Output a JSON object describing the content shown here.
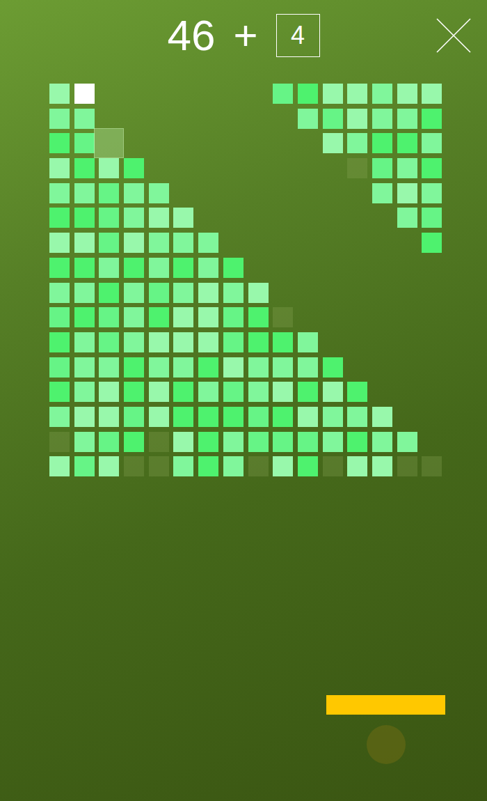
{
  "score": {
    "value": "46",
    "plus": "+",
    "bonus": "4"
  },
  "bricks": {
    "rows": [
      [
        {
          "kind": "brick",
          "color": "#98f8ab"
        },
        {
          "kind": "ball"
        },
        {
          "kind": "empty"
        },
        {
          "kind": "empty"
        },
        {
          "kind": "empty"
        },
        {
          "kind": "empty"
        },
        {
          "kind": "empty"
        },
        {
          "kind": "empty"
        },
        {
          "kind": "empty"
        },
        {
          "kind": "brick",
          "color": "#66f486"
        },
        {
          "kind": "brick",
          "color": "#4ef26e"
        },
        {
          "kind": "brick",
          "color": "#98f8ab"
        },
        {
          "kind": "brick",
          "color": "#98f8ab"
        },
        {
          "kind": "brick",
          "color": "#80f69b"
        },
        {
          "kind": "brick",
          "color": "#98f8ab"
        },
        {
          "kind": "brick",
          "color": "#98f8ab"
        }
      ],
      [
        {
          "kind": "brick",
          "color": "#80f69b"
        },
        {
          "kind": "brick",
          "color": "#80f69b"
        },
        {
          "kind": "empty"
        },
        {
          "kind": "empty"
        },
        {
          "kind": "empty"
        },
        {
          "kind": "empty"
        },
        {
          "kind": "empty"
        },
        {
          "kind": "empty"
        },
        {
          "kind": "empty"
        },
        {
          "kind": "empty"
        },
        {
          "kind": "brick",
          "color": "#80f69b"
        },
        {
          "kind": "brick",
          "color": "#66f486"
        },
        {
          "kind": "brick",
          "color": "#98f8ab"
        },
        {
          "kind": "brick",
          "color": "#80f69b"
        },
        {
          "kind": "brick",
          "color": "#80f69b"
        },
        {
          "kind": "brick",
          "color": "#4ef26e"
        }
      ],
      [
        {
          "kind": "brick",
          "color": "#4ef26e"
        },
        {
          "kind": "brick",
          "color": "#66f486"
        },
        {
          "kind": "fading"
        },
        {
          "kind": "empty"
        },
        {
          "kind": "empty"
        },
        {
          "kind": "empty"
        },
        {
          "kind": "empty"
        },
        {
          "kind": "empty"
        },
        {
          "kind": "empty"
        },
        {
          "kind": "empty"
        },
        {
          "kind": "empty"
        },
        {
          "kind": "brick",
          "color": "#98f8ab"
        },
        {
          "kind": "brick",
          "color": "#80f69b"
        },
        {
          "kind": "brick",
          "color": "#4ef26e"
        },
        {
          "kind": "brick",
          "color": "#4ef26e"
        },
        {
          "kind": "brick",
          "color": "#80f69b"
        }
      ],
      [
        {
          "kind": "brick",
          "color": "#98f8ab"
        },
        {
          "kind": "brick",
          "color": "#4ef26e"
        },
        {
          "kind": "brick",
          "color": "#98f8ab"
        },
        {
          "kind": "brick",
          "color": "#4ef26e"
        },
        {
          "kind": "empty"
        },
        {
          "kind": "empty"
        },
        {
          "kind": "empty"
        },
        {
          "kind": "empty"
        },
        {
          "kind": "empty"
        },
        {
          "kind": "empty"
        },
        {
          "kind": "empty"
        },
        {
          "kind": "empty"
        },
        {
          "kind": "hit"
        },
        {
          "kind": "brick",
          "color": "#66f486"
        },
        {
          "kind": "brick",
          "color": "#80f69b"
        },
        {
          "kind": "brick",
          "color": "#4ef26e"
        }
      ],
      [
        {
          "kind": "brick",
          "color": "#80f69b"
        },
        {
          "kind": "brick",
          "color": "#80f69b"
        },
        {
          "kind": "brick",
          "color": "#66f486"
        },
        {
          "kind": "brick",
          "color": "#80f69b"
        },
        {
          "kind": "brick",
          "color": "#80f69b"
        },
        {
          "kind": "empty"
        },
        {
          "kind": "empty"
        },
        {
          "kind": "empty"
        },
        {
          "kind": "empty"
        },
        {
          "kind": "empty"
        },
        {
          "kind": "empty"
        },
        {
          "kind": "empty"
        },
        {
          "kind": "empty"
        },
        {
          "kind": "brick",
          "color": "#80f69b"
        },
        {
          "kind": "brick",
          "color": "#98f8ab"
        },
        {
          "kind": "brick",
          "color": "#80f69b"
        }
      ],
      [
        {
          "kind": "brick",
          "color": "#4ef26e"
        },
        {
          "kind": "brick",
          "color": "#4ef26e"
        },
        {
          "kind": "brick",
          "color": "#66f486"
        },
        {
          "kind": "brick",
          "color": "#80f69b"
        },
        {
          "kind": "brick",
          "color": "#98f8ab"
        },
        {
          "kind": "brick",
          "color": "#98f8ab"
        },
        {
          "kind": "empty"
        },
        {
          "kind": "empty"
        },
        {
          "kind": "empty"
        },
        {
          "kind": "empty"
        },
        {
          "kind": "empty"
        },
        {
          "kind": "empty"
        },
        {
          "kind": "empty"
        },
        {
          "kind": "empty"
        },
        {
          "kind": "brick",
          "color": "#80f69b"
        },
        {
          "kind": "brick",
          "color": "#66f486"
        }
      ],
      [
        {
          "kind": "brick",
          "color": "#98f8ab"
        },
        {
          "kind": "brick",
          "color": "#98f8ab"
        },
        {
          "kind": "brick",
          "color": "#66f486"
        },
        {
          "kind": "brick",
          "color": "#98f8ab"
        },
        {
          "kind": "brick",
          "color": "#80f69b"
        },
        {
          "kind": "brick",
          "color": "#80f69b"
        },
        {
          "kind": "brick",
          "color": "#80f69b"
        },
        {
          "kind": "empty"
        },
        {
          "kind": "empty"
        },
        {
          "kind": "empty"
        },
        {
          "kind": "empty"
        },
        {
          "kind": "empty"
        },
        {
          "kind": "empty"
        },
        {
          "kind": "empty"
        },
        {
          "kind": "empty"
        },
        {
          "kind": "brick",
          "color": "#4ef26e"
        }
      ],
      [
        {
          "kind": "brick",
          "color": "#4ef26e"
        },
        {
          "kind": "brick",
          "color": "#4ef26e"
        },
        {
          "kind": "brick",
          "color": "#80f69b"
        },
        {
          "kind": "brick",
          "color": "#4ef26e"
        },
        {
          "kind": "brick",
          "color": "#80f69b"
        },
        {
          "kind": "brick",
          "color": "#4ef26e"
        },
        {
          "kind": "brick",
          "color": "#80f69b"
        },
        {
          "kind": "brick",
          "color": "#4ef26e"
        },
        {
          "kind": "empty"
        },
        {
          "kind": "empty"
        },
        {
          "kind": "empty"
        },
        {
          "kind": "empty"
        },
        {
          "kind": "empty"
        },
        {
          "kind": "empty"
        },
        {
          "kind": "empty"
        },
        {
          "kind": "empty"
        }
      ],
      [
        {
          "kind": "brick",
          "color": "#80f69b"
        },
        {
          "kind": "brick",
          "color": "#80f69b"
        },
        {
          "kind": "brick",
          "color": "#4ef26e"
        },
        {
          "kind": "brick",
          "color": "#80f69b"
        },
        {
          "kind": "brick",
          "color": "#66f486"
        },
        {
          "kind": "brick",
          "color": "#80f69b"
        },
        {
          "kind": "brick",
          "color": "#98f8ab"
        },
        {
          "kind": "brick",
          "color": "#80f69b"
        },
        {
          "kind": "brick",
          "color": "#98f8ab"
        },
        {
          "kind": "empty"
        },
        {
          "kind": "empty"
        },
        {
          "kind": "empty"
        },
        {
          "kind": "empty"
        },
        {
          "kind": "empty"
        },
        {
          "kind": "empty"
        },
        {
          "kind": "empty"
        }
      ],
      [
        {
          "kind": "brick",
          "color": "#66f486"
        },
        {
          "kind": "brick",
          "color": "#4ef26e"
        },
        {
          "kind": "brick",
          "color": "#66f486"
        },
        {
          "kind": "brick",
          "color": "#80f69b"
        },
        {
          "kind": "brick",
          "color": "#4ef26e"
        },
        {
          "kind": "brick",
          "color": "#98f8ab"
        },
        {
          "kind": "brick",
          "color": "#98f8ab"
        },
        {
          "kind": "brick",
          "color": "#66f486"
        },
        {
          "kind": "brick",
          "color": "#4ef26e"
        },
        {
          "kind": "hit"
        },
        {
          "kind": "empty"
        },
        {
          "kind": "empty"
        },
        {
          "kind": "empty"
        },
        {
          "kind": "empty"
        },
        {
          "kind": "empty"
        },
        {
          "kind": "empty"
        }
      ],
      [
        {
          "kind": "brick",
          "color": "#4ef26e"
        },
        {
          "kind": "brick",
          "color": "#80f69b"
        },
        {
          "kind": "brick",
          "color": "#66f486"
        },
        {
          "kind": "brick",
          "color": "#80f69b"
        },
        {
          "kind": "brick",
          "color": "#98f8ab"
        },
        {
          "kind": "brick",
          "color": "#98f8ab"
        },
        {
          "kind": "brick",
          "color": "#98f8ab"
        },
        {
          "kind": "brick",
          "color": "#66f486"
        },
        {
          "kind": "brick",
          "color": "#4ef26e"
        },
        {
          "kind": "brick",
          "color": "#4ef26e"
        },
        {
          "kind": "brick",
          "color": "#80f69b"
        },
        {
          "kind": "empty"
        },
        {
          "kind": "empty"
        },
        {
          "kind": "empty"
        },
        {
          "kind": "empty"
        },
        {
          "kind": "empty"
        }
      ],
      [
        {
          "kind": "brick",
          "color": "#66f486"
        },
        {
          "kind": "brick",
          "color": "#80f69b"
        },
        {
          "kind": "brick",
          "color": "#80f69b"
        },
        {
          "kind": "brick",
          "color": "#4ef26e"
        },
        {
          "kind": "brick",
          "color": "#80f69b"
        },
        {
          "kind": "brick",
          "color": "#80f69b"
        },
        {
          "kind": "brick",
          "color": "#4ef26e"
        },
        {
          "kind": "brick",
          "color": "#98f8ab"
        },
        {
          "kind": "brick",
          "color": "#80f69b"
        },
        {
          "kind": "brick",
          "color": "#80f69b"
        },
        {
          "kind": "brick",
          "color": "#80f69b"
        },
        {
          "kind": "brick",
          "color": "#4ef26e"
        },
        {
          "kind": "empty"
        },
        {
          "kind": "empty"
        },
        {
          "kind": "empty"
        },
        {
          "kind": "empty"
        }
      ],
      [
        {
          "kind": "brick",
          "color": "#4ef26e"
        },
        {
          "kind": "brick",
          "color": "#80f69b"
        },
        {
          "kind": "brick",
          "color": "#98f8ab"
        },
        {
          "kind": "brick",
          "color": "#4ef26e"
        },
        {
          "kind": "brick",
          "color": "#98f8ab"
        },
        {
          "kind": "brick",
          "color": "#4ef26e"
        },
        {
          "kind": "brick",
          "color": "#80f69b"
        },
        {
          "kind": "brick",
          "color": "#66f486"
        },
        {
          "kind": "brick",
          "color": "#80f69b"
        },
        {
          "kind": "brick",
          "color": "#98f8ab"
        },
        {
          "kind": "brick",
          "color": "#4ef26e"
        },
        {
          "kind": "brick",
          "color": "#98f8ab"
        },
        {
          "kind": "brick",
          "color": "#4ef26e"
        },
        {
          "kind": "empty"
        },
        {
          "kind": "empty"
        },
        {
          "kind": "empty"
        }
      ],
      [
        {
          "kind": "brick",
          "color": "#80f69b"
        },
        {
          "kind": "brick",
          "color": "#98f8ab"
        },
        {
          "kind": "brick",
          "color": "#98f8ab"
        },
        {
          "kind": "brick",
          "color": "#66f486"
        },
        {
          "kind": "brick",
          "color": "#98f8ab"
        },
        {
          "kind": "brick",
          "color": "#4ef26e"
        },
        {
          "kind": "brick",
          "color": "#4ef26e"
        },
        {
          "kind": "brick",
          "color": "#4ef26e"
        },
        {
          "kind": "brick",
          "color": "#66f486"
        },
        {
          "kind": "brick",
          "color": "#4ef26e"
        },
        {
          "kind": "brick",
          "color": "#98f8ab"
        },
        {
          "kind": "brick",
          "color": "#80f69b"
        },
        {
          "kind": "brick",
          "color": "#80f69b"
        },
        {
          "kind": "brick",
          "color": "#98f8ab"
        },
        {
          "kind": "empty"
        },
        {
          "kind": "empty"
        }
      ],
      [
        {
          "kind": "hit"
        },
        {
          "kind": "brick",
          "color": "#80f69b"
        },
        {
          "kind": "brick",
          "color": "#66f486"
        },
        {
          "kind": "brick",
          "color": "#4ef26e"
        },
        {
          "kind": "hit"
        },
        {
          "kind": "brick",
          "color": "#98f8ab"
        },
        {
          "kind": "brick",
          "color": "#4ef26e"
        },
        {
          "kind": "brick",
          "color": "#80f69b"
        },
        {
          "kind": "brick",
          "color": "#66f486"
        },
        {
          "kind": "brick",
          "color": "#66f486"
        },
        {
          "kind": "brick",
          "color": "#66f486"
        },
        {
          "kind": "brick",
          "color": "#80f69b"
        },
        {
          "kind": "brick",
          "color": "#4ef26e"
        },
        {
          "kind": "brick",
          "color": "#80f69b"
        },
        {
          "kind": "brick",
          "color": "#80f69b"
        },
        {
          "kind": "empty"
        }
      ],
      [
        {
          "kind": "brick",
          "color": "#98f8ab"
        },
        {
          "kind": "brick",
          "color": "#66f486"
        },
        {
          "kind": "brick",
          "color": "#98f8ab"
        },
        {
          "kind": "hit"
        },
        {
          "kind": "hit"
        },
        {
          "kind": "brick",
          "color": "#80f69b"
        },
        {
          "kind": "brick",
          "color": "#4ef26e"
        },
        {
          "kind": "brick",
          "color": "#80f69b"
        },
        {
          "kind": "hit"
        },
        {
          "kind": "brick",
          "color": "#98f8ab"
        },
        {
          "kind": "brick",
          "color": "#4ef26e"
        },
        {
          "kind": "hit"
        },
        {
          "kind": "brick",
          "color": "#98f8ab"
        },
        {
          "kind": "brick",
          "color": "#98f8ab"
        },
        {
          "kind": "hit"
        },
        {
          "kind": "hit"
        }
      ]
    ]
  }
}
